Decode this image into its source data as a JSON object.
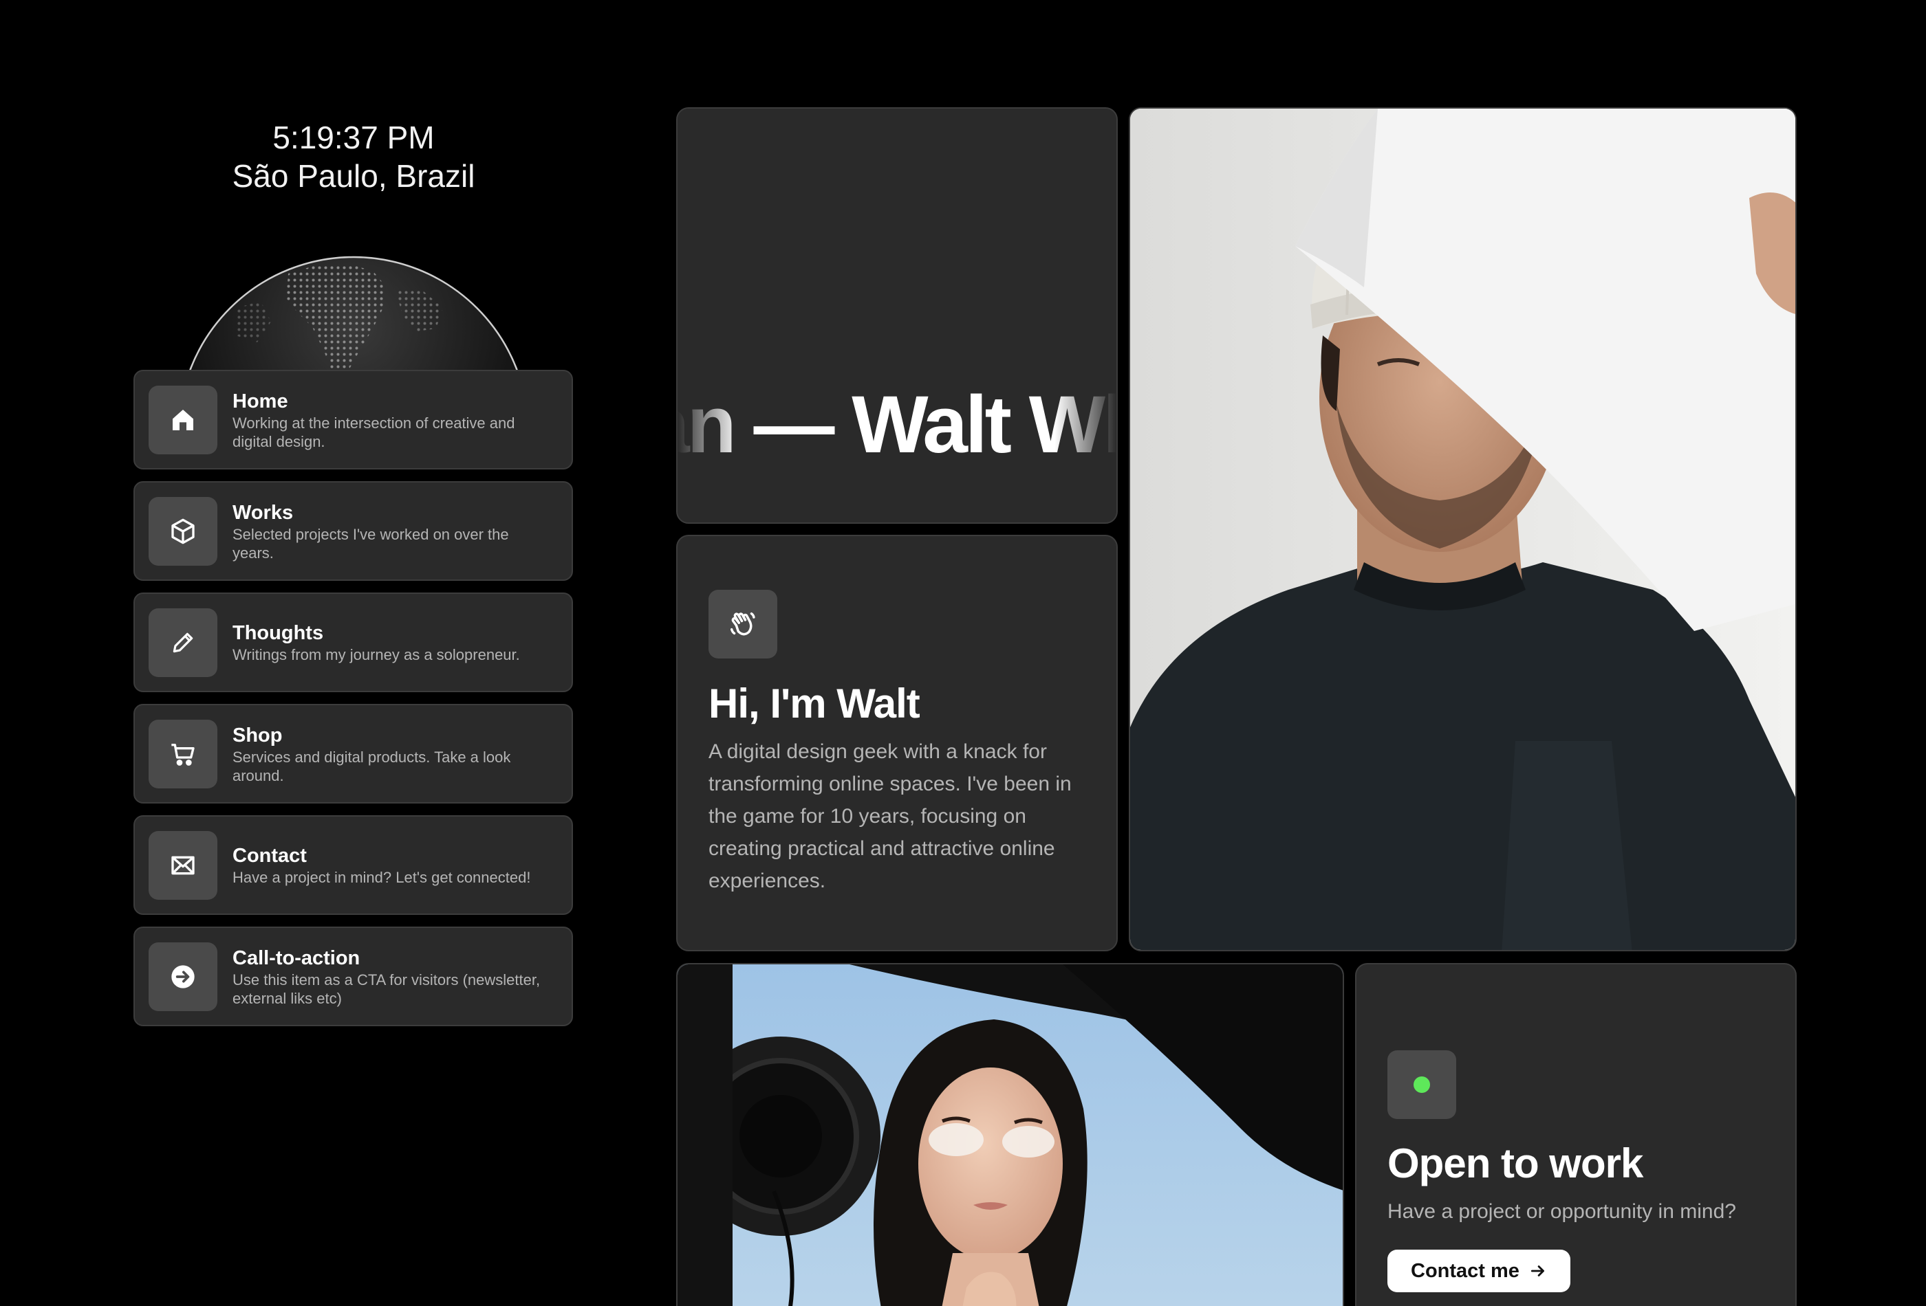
{
  "clock": {
    "time": "5:19:37 PM",
    "location": "São Paulo, Brazil"
  },
  "nav": {
    "items": [
      {
        "title": "Home",
        "description": "Working at the intersection of creative and digital design.",
        "icon": "home-icon"
      },
      {
        "title": "Works",
        "description": "Selected projects I've worked on over the years.",
        "icon": "box-icon"
      },
      {
        "title": "Thoughts",
        "description": "Writings from my journey as a solopreneur.",
        "icon": "pencil-icon"
      },
      {
        "title": "Shop",
        "description": "Services and digital products. Take a look around.",
        "icon": "cart-icon"
      },
      {
        "title": "Contact",
        "description": "Have a project in mind? Let's get connected!",
        "icon": "mail-icon"
      },
      {
        "title": "Call-to-action",
        "description": "Use this item as a CTA for visitors (newsletter, external liks etc)",
        "icon": "arrow-circle-icon"
      }
    ]
  },
  "marquee": {
    "text": "an — Walt Wh"
  },
  "intro": {
    "icon": "wave-hand-icon",
    "title": "Hi, I'm Walt",
    "text": "A digital design geek with a knack for transforming online spaces. I've been in the game for 10 years, focusing on creating practical and attractive online experiences."
  },
  "open": {
    "title": "Open to work",
    "subtitle": "Have a project or opportunity in mind?",
    "button_label": "Contact me",
    "status_color": "#5ee85a"
  },
  "colors": {
    "background": "#000000",
    "card": "#2a2a2a",
    "card_border": "#3c3c3c",
    "icon_tile": "#4a4a4a"
  }
}
